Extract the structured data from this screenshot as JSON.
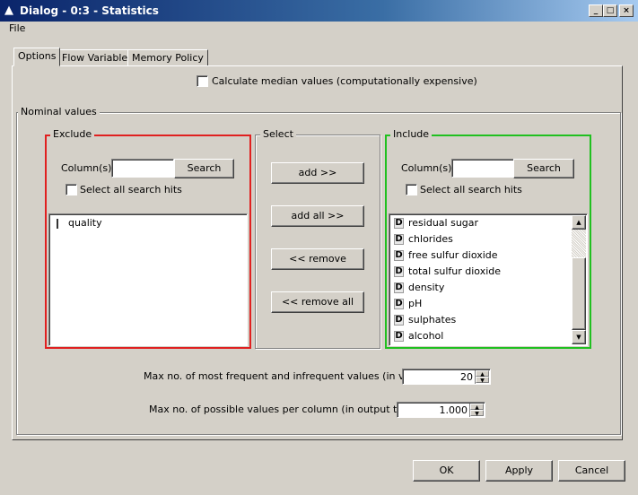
{
  "window": {
    "title": "Dialog - 0:3 - Statistics"
  },
  "menu": {
    "file": "File"
  },
  "tabs": [
    {
      "label": "Options",
      "active": true
    },
    {
      "label": "Flow Variables"
    },
    {
      "label": "Memory Policy"
    }
  ],
  "options": {
    "median_label": "Calculate median values (computationally expensive)",
    "median_checked": false,
    "nominal_title": "Nominal values",
    "exclude": {
      "title": "Exclude",
      "color": "#e02020",
      "column_label": "Column(s):",
      "search_value": "",
      "search_button": "Search",
      "select_all_label": "Select all search hits",
      "items": [
        {
          "label": "quality",
          "type": "integer"
        }
      ]
    },
    "select": {
      "title": "Select",
      "add": "add >>",
      "add_all": "add all >>",
      "remove": "<< remove",
      "remove_all": "<< remove all"
    },
    "include": {
      "title": "Include",
      "color": "#20c020",
      "column_label": "Column(s):",
      "search_value": "",
      "search_button": "Search",
      "select_all_label": "Select all search hits",
      "items": [
        {
          "label": "residual sugar"
        },
        {
          "label": "chlorides"
        },
        {
          "label": "free sulfur dioxide"
        },
        {
          "label": "total sulfur dioxide"
        },
        {
          "label": "density"
        },
        {
          "label": "pH"
        },
        {
          "label": "sulphates"
        },
        {
          "label": "alcohol"
        }
      ]
    },
    "max_freq_label": "Max no. of most frequent and infrequent values (in view):",
    "max_freq_value": "20",
    "max_possible_label": "Max no. of possible values per column (in output table):",
    "max_possible_value": "1.000"
  },
  "buttons": {
    "ok": "OK",
    "apply": "Apply",
    "cancel": "Cancel"
  }
}
